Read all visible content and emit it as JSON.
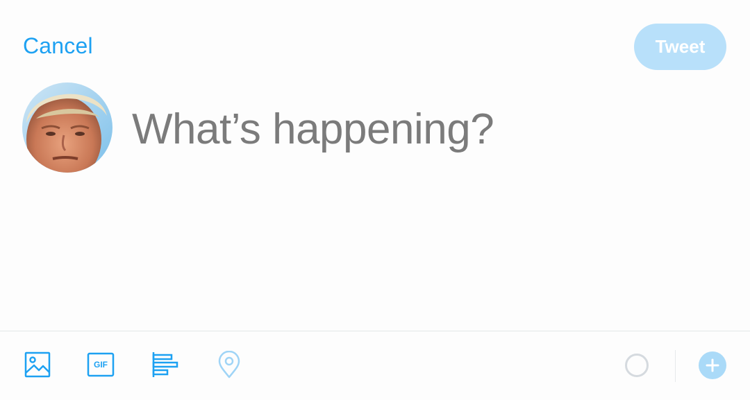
{
  "header": {
    "cancel_label": "Cancel",
    "tweet_label": "Tweet"
  },
  "compose": {
    "placeholder": "What’s happening?",
    "value": ""
  },
  "toolbar": {
    "icons": [
      "image-icon",
      "gif-icon",
      "poll-icon",
      "location-icon"
    ],
    "gif_label": "GIF"
  },
  "colors": {
    "accent": "#1da1f2",
    "tweet_button_disabled": "#b8e0fa",
    "placeholder_text": "#7b7b7b"
  }
}
